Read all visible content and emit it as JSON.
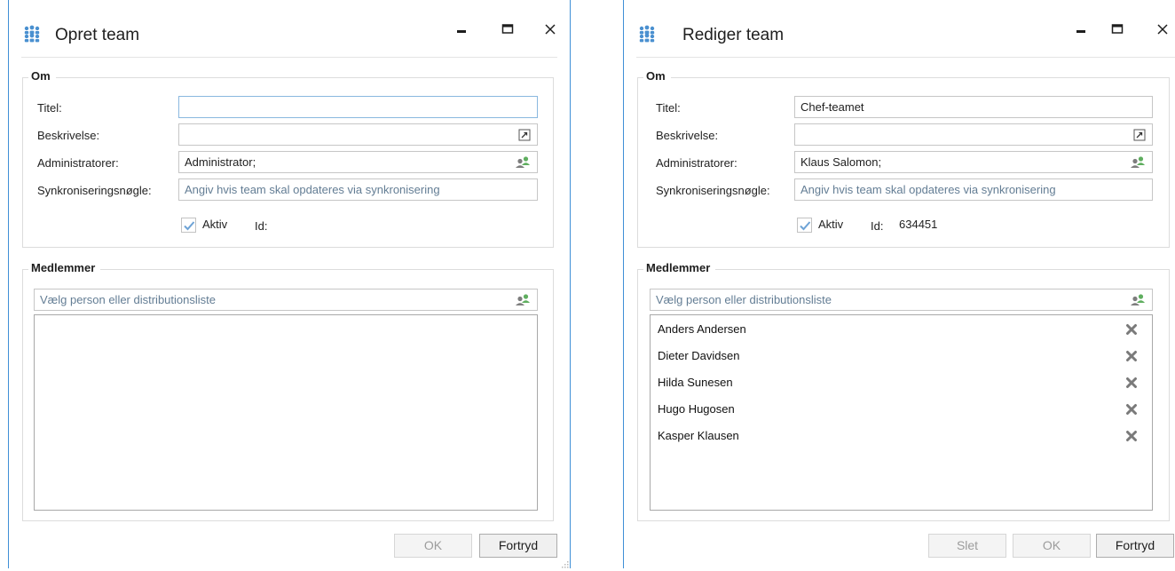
{
  "create_dialog": {
    "title": "Opret team",
    "about": {
      "legend": "Om",
      "title_label": "Titel:",
      "title_value": "",
      "description_label": "Beskrivelse:",
      "description_value": "",
      "admins_label": "Administratorer:",
      "admins_value": "Administrator;",
      "sync_key_label": "Synkroniseringsnøgle:",
      "sync_key_placeholder": "Angiv hvis team skal opdateres via synkronisering",
      "active_label": "Aktiv",
      "active_checked": true,
      "id_label": "Id:",
      "id_value": ""
    },
    "members": {
      "legend": "Medlemmer",
      "picker_placeholder": "Vælg person eller distributionsliste",
      "items": []
    },
    "buttons": {
      "ok": "OK",
      "cancel": "Fortryd"
    }
  },
  "edit_dialog": {
    "title": "Rediger team",
    "about": {
      "legend": "Om",
      "title_label": "Titel:",
      "title_value": "Chef-teamet",
      "description_label": "Beskrivelse:",
      "description_value": "",
      "admins_label": "Administratorer:",
      "admins_value": "Klaus Salomon;",
      "sync_key_label": "Synkroniseringsnøgle:",
      "sync_key_placeholder": "Angiv hvis team skal opdateres via synkronisering",
      "active_label": "Aktiv",
      "active_checked": true,
      "id_label": "Id:",
      "id_value": "634451"
    },
    "members": {
      "legend": "Medlemmer",
      "picker_placeholder": "Vælg person eller distributionsliste",
      "items": [
        {
          "name": "Anders Andersen"
        },
        {
          "name": "Dieter Davidsen"
        },
        {
          "name": "Hilda Sunesen"
        },
        {
          "name": "Hugo Hugosen"
        },
        {
          "name": "Kasper Klausen"
        }
      ]
    },
    "buttons": {
      "delete": "Slet",
      "ok": "OK",
      "cancel": "Fortryd"
    }
  },
  "icons": {
    "team": "team-icon",
    "minimize": "minimize-icon",
    "maximize": "maximize-icon",
    "close": "close-icon",
    "expand": "expand-text-icon",
    "person_picker": "person-picker-icon",
    "remove": "remove-member-icon",
    "check": "checkmark-icon",
    "resize": "resize-grip-icon"
  },
  "colors": {
    "accent": "#3f8fd6",
    "team_icon": "#4a90d0",
    "placeholder_text": "#637d94",
    "focus_border": "#8ab8df",
    "checkmark": "#6ea3d6",
    "remove_icon": "#7a7a7a"
  }
}
